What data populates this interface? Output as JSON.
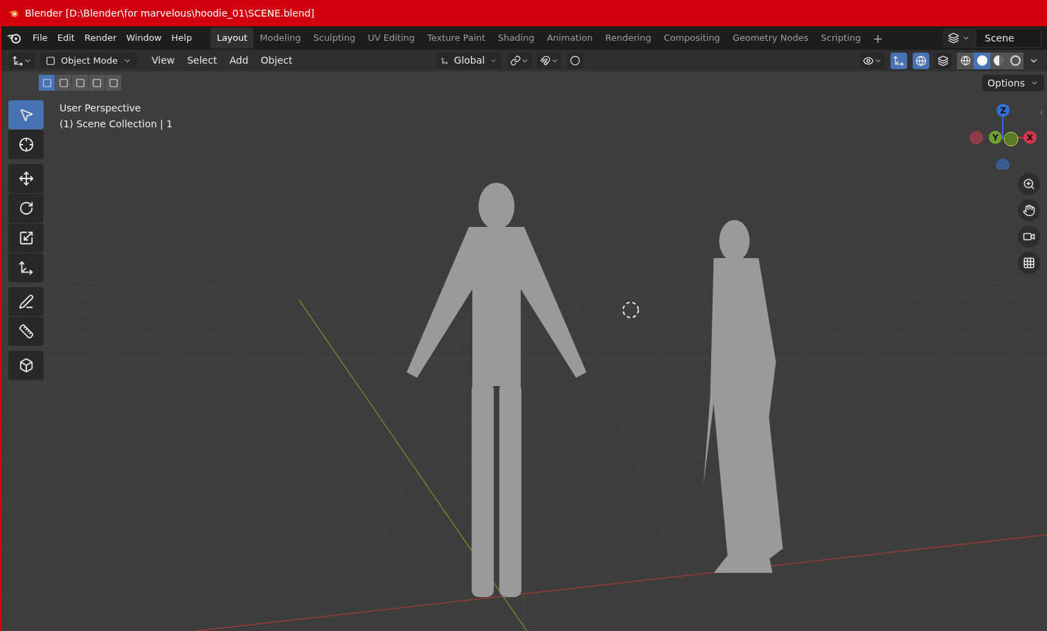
{
  "window": {
    "title": "Blender [D:\\Blender\\for marvelous\\hoodie_01\\SCENE.blend]"
  },
  "menu": [
    "File",
    "Edit",
    "Render",
    "Window",
    "Help"
  ],
  "workspaces": [
    {
      "label": "Layout",
      "selected": true
    },
    {
      "label": "Modeling",
      "selected": false
    },
    {
      "label": "Sculpting",
      "selected": false
    },
    {
      "label": "UV Editing",
      "selected": false
    },
    {
      "label": "Texture Paint",
      "selected": false
    },
    {
      "label": "Shading",
      "selected": false
    },
    {
      "label": "Animation",
      "selected": false
    },
    {
      "label": "Rendering",
      "selected": false
    },
    {
      "label": "Compositing",
      "selected": false
    },
    {
      "label": "Geometry Nodes",
      "selected": false
    },
    {
      "label": "Scripting",
      "selected": false
    }
  ],
  "add_workspace": "+",
  "scene": "Scene",
  "header": {
    "mode": "Object Mode",
    "menus": [
      "View",
      "Select",
      "Add",
      "Object"
    ],
    "orientation": "Global",
    "snap_on": false,
    "proportional_on": false,
    "gizmos_on": true,
    "overlays_on": true,
    "xray_on": false,
    "select_modes": [
      {
        "selected": true
      },
      {
        "selected": false
      },
      {
        "selected": false
      },
      {
        "selected": false
      },
      {
        "selected": false
      }
    ],
    "shading": [
      {
        "kind": "wireframe",
        "selected": false
      },
      {
        "kind": "solid",
        "selected": true
      },
      {
        "kind": "material",
        "selected": false
      },
      {
        "kind": "rendered",
        "selected": false
      }
    ],
    "options": "Options"
  },
  "viewport": {
    "view_name": "User Perspective",
    "collection": "(1) Scene Collection | 1",
    "axes": [
      {
        "label": "Z",
        "color": "#2f6fd6"
      },
      {
        "label": "Y",
        "color": "#6ea12f"
      },
      {
        "label": "X",
        "color": "#d6344c"
      }
    ]
  },
  "tools": [
    {
      "kind": "select",
      "selected": true
    },
    {
      "kind": "cursor",
      "selected": false
    },
    {
      "kind": "move",
      "selected": false
    },
    {
      "kind": "rotate",
      "selected": false
    },
    {
      "kind": "scale",
      "selected": false
    },
    {
      "kind": "transform",
      "selected": false
    },
    {
      "kind": "annotate",
      "selected": false
    },
    {
      "kind": "measure",
      "selected": false
    },
    {
      "kind": "add-cube",
      "selected": false
    }
  ],
  "nav": [
    {
      "kind": "zoom"
    },
    {
      "kind": "pan"
    },
    {
      "kind": "camera"
    },
    {
      "kind": "ortho"
    }
  ]
}
